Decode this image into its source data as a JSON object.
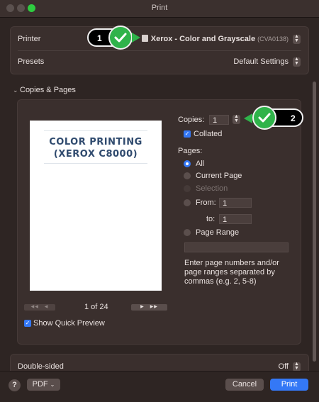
{
  "window": {
    "title": "Print"
  },
  "printer": {
    "label": "Printer",
    "name": "Xerox - Color and Grayscale",
    "id": "(CVA0138)"
  },
  "presets": {
    "label": "Presets",
    "value": "Default Settings"
  },
  "section": {
    "title": "Copies & Pages"
  },
  "preview": {
    "line1": "COLOR PRINTING",
    "line2": "(XEROX C8000)",
    "page_count": "1 of 24",
    "show_quick_preview": "Show Quick Preview"
  },
  "copies": {
    "label": "Copies:",
    "value": "1",
    "collated": "Collated"
  },
  "pages": {
    "label": "Pages:",
    "all": "All",
    "current": "Current Page",
    "selection": "Selection",
    "from_label": "From:",
    "from_value": "1",
    "to_label": "to:",
    "to_value": "1",
    "range": "Page Range",
    "help": "Enter page numbers and/or page ranges separated by commas (e.g. 2, 5-8)"
  },
  "double_sided": {
    "label": "Double-sided",
    "value": "Off"
  },
  "bottom": {
    "help": "?",
    "pdf": "PDF",
    "cancel": "Cancel",
    "print": "Print"
  },
  "badges": {
    "one": "1",
    "two": "2"
  },
  "colors": {
    "accent": "#3478f6",
    "check_green": "#2fb34a"
  }
}
